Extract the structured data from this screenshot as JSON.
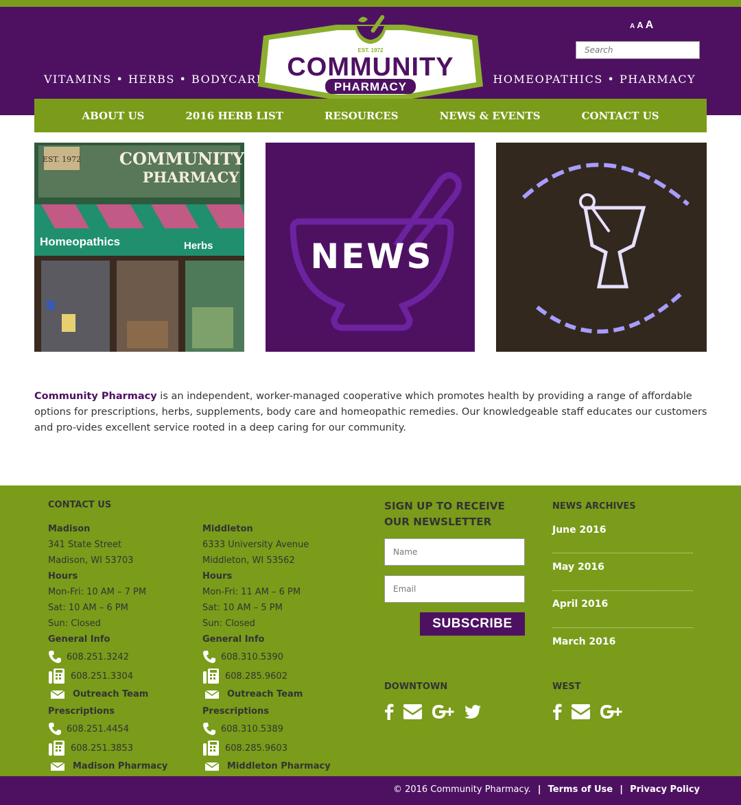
{
  "header": {
    "tagline_left": "VITAMINS • HERBS • BODYCARE",
    "tagline_right": "HOMEOPATHICS • PHARMACY",
    "text_size": [
      "A",
      "A",
      "A"
    ],
    "search_placeholder": "Search",
    "logo": {
      "est": "EST. 1972",
      "word1": "COMMUNITY",
      "word2": "PHARMACY"
    }
  },
  "nav": [
    "ABOUT US",
    "2016 HERB LIST",
    "RESOURCES",
    "NEWS & EVENTS",
    "CONTACT US"
  ],
  "tiles": {
    "storefront": {
      "est": "EST. 1972",
      "sign1": "COMMUNITY",
      "sign2": "PHARMACY",
      "awning_left": "Homeopathics",
      "awning_right": "Herbs"
    },
    "news": "NEWS"
  },
  "intro": {
    "brand": "Community Pharmacy",
    "text": " is an independent, worker-managed cooperative which promotes health by providing a range of affordable options for prescriptions, herbs, supplements, body care and homeopathic remedies. Our knowledgeable staff educates our customers and pro-vides excellent service rooted in a deep caring for our community."
  },
  "footer": {
    "contact_heading": "CONTACT US",
    "madison": {
      "name": "Madison",
      "street": "341 State Street",
      "city": "Madison, WI 53703",
      "hours_label": "Hours",
      "hours": [
        "Mon-Fri: 10 AM – 7 PM",
        "Sat: 10 AM – 6 PM",
        "Sun: Closed"
      ],
      "general_label": "General Info",
      "general_phone": "608.251.3242",
      "general_fax": "608.251.3304",
      "general_mail": "Outreach Team",
      "rx_label": "Prescriptions",
      "rx_phone": "608.251.4454",
      "rx_fax": "608.251.3853",
      "rx_mail": "Madison Pharmacy"
    },
    "middleton": {
      "name": "Middleton",
      "street": "6333 University Avenue",
      "city": "Middleton, WI 53562",
      "hours_label": "Hours",
      "hours": [
        "Mon-Fri: 11 AM – 6 PM",
        "Sat: 10 AM – 5 PM",
        "Sun: Closed"
      ],
      "general_label": "General Info",
      "general_phone": "608.310.5390",
      "general_fax": "608.285.9602",
      "general_mail": "Outreach Team",
      "rx_label": "Prescriptions",
      "rx_phone": "608.310.5389",
      "rx_fax": "608.285.9603",
      "rx_mail": "Middleton Pharmacy"
    },
    "newsletter": {
      "heading_line1": "SIGN UP TO RECEIVE",
      "heading_line2": "OUR NEWSLETTER",
      "name_placeholder": "Name",
      "email_placeholder": "Email",
      "button": "SUBSCRIBE"
    },
    "archives": {
      "heading": "NEWS ARCHIVES",
      "items": [
        "June 2016",
        "May 2016",
        "April 2016",
        "March 2016"
      ]
    },
    "downtown_heading": "DOWNTOWN",
    "west_heading": "WEST",
    "downtown_icons": [
      "facebook-icon",
      "email-icon",
      "google-plus-icon",
      "twitter-icon"
    ],
    "west_icons": [
      "facebook-icon",
      "email-icon",
      "google-plus-icon"
    ]
  },
  "bottom": {
    "copyright": "© 2016 Community Pharmacy.",
    "separator": "|",
    "terms": "Terms of Use",
    "privacy": "Privacy Policy"
  },
  "colors": {
    "purple": "#4e1162",
    "green": "#7a9c1a",
    "logo_green": "#8cb02e"
  }
}
